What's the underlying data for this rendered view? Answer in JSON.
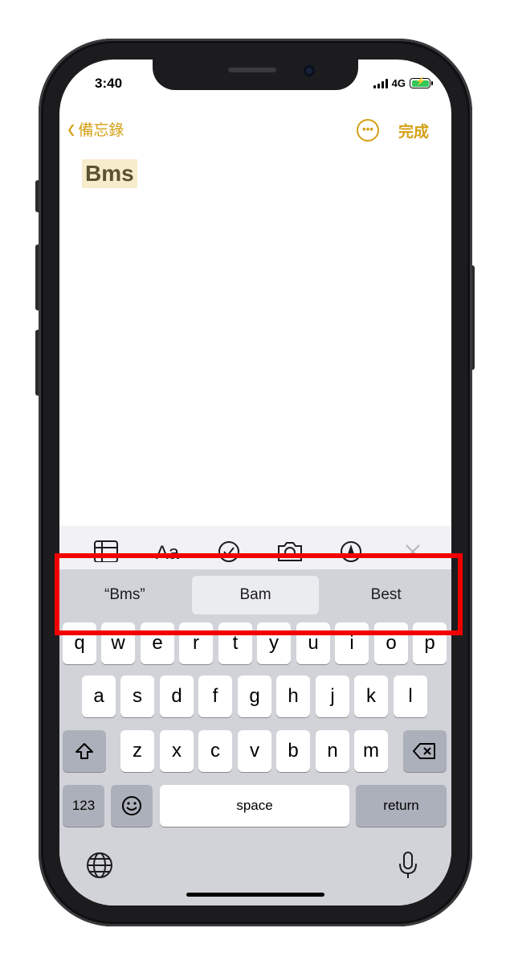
{
  "status_bar": {
    "time": "3:40",
    "network": "4G"
  },
  "nav": {
    "back_label": "備忘錄",
    "more_icon": "ellipsis-circle-icon",
    "done_label": "完成"
  },
  "note": {
    "text": "Bms"
  },
  "toolbar": {
    "icons": [
      "table-icon",
      "text-format-icon",
      "checklist-icon",
      "camera-icon",
      "markup-icon",
      "close-icon"
    ],
    "format_label": "Aa"
  },
  "suggestions": [
    {
      "label": "“Bms”"
    },
    {
      "label": "Bam"
    },
    {
      "label": "Best"
    }
  ],
  "keyboard": {
    "row1": [
      "q",
      "w",
      "e",
      "r",
      "t",
      "y",
      "u",
      "i",
      "o",
      "p"
    ],
    "row2": [
      "a",
      "s",
      "d",
      "f",
      "g",
      "h",
      "j",
      "k",
      "l"
    ],
    "row3": [
      "z",
      "x",
      "c",
      "v",
      "b",
      "n",
      "m"
    ],
    "numbers_label": "123",
    "space_label": "space",
    "return_label": "return"
  },
  "colors": {
    "accent": "#d4a017",
    "highlight_border": "#f20000"
  }
}
